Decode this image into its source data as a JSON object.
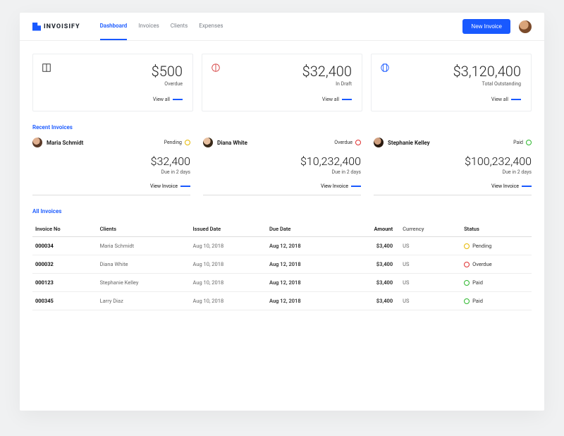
{
  "brand": {
    "name": "INVOISIFY"
  },
  "nav": {
    "items": [
      {
        "label": "Dashboard",
        "active": true
      },
      {
        "label": "Invoices",
        "active": false
      },
      {
        "label": "Clients",
        "active": false
      },
      {
        "label": "Expenses",
        "active": false
      }
    ]
  },
  "header": {
    "new_invoice": "New Invoice"
  },
  "summary": [
    {
      "amount": "$500",
      "label": "Overdue",
      "link": "View all",
      "icon": "overdue"
    },
    {
      "amount": "$32,400",
      "label": "In Draft",
      "link": "View all",
      "icon": "draft"
    },
    {
      "amount": "$3,120,400",
      "label": "Total Outstanding",
      "link": "View all",
      "icon": "outstanding"
    }
  ],
  "recent": {
    "title": "Recent Invoices",
    "items": [
      {
        "name": "Maria Schmidt",
        "status": "Pending",
        "status_kind": "pending",
        "amount": "$32,400",
        "due": "Due in 2 days",
        "link": "View Invoice"
      },
      {
        "name": "Diana White",
        "status": "Overdue",
        "status_kind": "overdue",
        "amount": "$10,232,400",
        "due": "Due in 2 days",
        "link": "View Invoice"
      },
      {
        "name": "Stephanie Kelley",
        "status": "Paid",
        "status_kind": "paid",
        "amount": "$100,232,400",
        "due": "Due in 2 days",
        "link": "View Invoice"
      }
    ]
  },
  "table": {
    "title": "All Invoices",
    "headers": {
      "no": "Invoice No",
      "client": "Clients",
      "issued": "Issued Date",
      "due": "Due Date",
      "amount": "Amount",
      "currency": "Currency",
      "status": "Status"
    },
    "rows": [
      {
        "no": "000034",
        "client": "Maria Schmidt",
        "issued": "Aug 10, 2018",
        "due": "Aug 12, 2018",
        "amount": "$3,400",
        "currency": "US",
        "status": "Pending",
        "status_kind": "pending"
      },
      {
        "no": "000032",
        "client": "Diana White",
        "issued": "Aug 10, 2018",
        "due": "Aug 12, 2018",
        "amount": "$3,400",
        "currency": "US",
        "status": "Overdue",
        "status_kind": "overdue"
      },
      {
        "no": "000123",
        "client": "Stephanie Kelley",
        "issued": "Aug 10, 2018",
        "due": "Aug 12, 2018",
        "amount": "$3,400",
        "currency": "US",
        "status": "Paid",
        "status_kind": "paid"
      },
      {
        "no": "000345",
        "client": "Larry Diaz",
        "issued": "Aug 10, 2018",
        "due": "Aug 12, 2018",
        "amount": "$3,400",
        "currency": "US",
        "status": "Paid",
        "status_kind": "paid"
      }
    ]
  }
}
